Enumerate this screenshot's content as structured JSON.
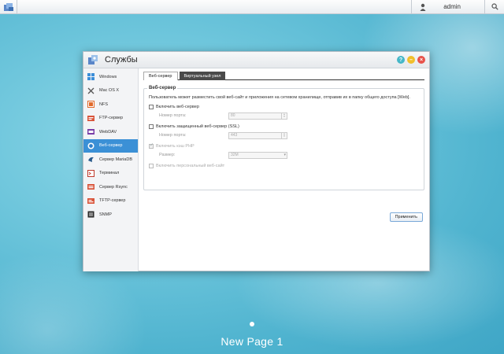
{
  "topbar": {
    "user_name": "admin"
  },
  "window": {
    "title": "Службы"
  },
  "sidebar": {
    "items": [
      {
        "label": "Windows",
        "icon": "windows-icon",
        "active": false
      },
      {
        "label": "Mac OS X",
        "icon": "mac-icon",
        "active": false
      },
      {
        "label": "NFS",
        "icon": "nfs-icon",
        "active": false
      },
      {
        "label": "FTP-сервер",
        "icon": "ftp-icon",
        "active": false
      },
      {
        "label": "WebDAV",
        "icon": "webdav-icon",
        "active": false
      },
      {
        "label": "Веб-сервер",
        "icon": "web-server-icon",
        "active": true
      },
      {
        "label": "Сервер MariaDB",
        "icon": "mariadb-icon",
        "active": false
      },
      {
        "label": "Терминал",
        "icon": "terminal-icon",
        "active": false
      },
      {
        "label": "Сервер Rsync",
        "icon": "rsync-icon",
        "active": false
      },
      {
        "label": "TFTP-сервер",
        "icon": "tftp-icon",
        "active": false
      },
      {
        "label": "SNMP",
        "icon": "snmp-icon",
        "active": false
      }
    ]
  },
  "tabs": [
    {
      "label": "Веб-сервер",
      "active": true
    },
    {
      "label": "Виртуальный узел",
      "active": false
    }
  ],
  "section": {
    "legend": "Веб-сервер",
    "description": "Пользователь может разместить свой веб-сайт и приложения на сетевом хранилище, отправив их в папку общего доступа [Web].",
    "enable_web": {
      "label": "Включить веб-сервер",
      "checked": false
    },
    "port_label": "Номер порта:",
    "port_value": "80",
    "enable_ssl": {
      "label": "Включить защищенный веб-сервер (SSL)",
      "checked": false
    },
    "ssl_port_label": "Номер порта:",
    "ssl_port_value": "443",
    "php_cache": {
      "label": "Включить кэш PHP",
      "checked": true,
      "disabled": true
    },
    "size_label": "Размер:",
    "size_value": "32M",
    "personal_site": {
      "label": "Включить персональный веб-сайт",
      "checked": false,
      "disabled": true
    }
  },
  "apply_label": "Применить",
  "page_label": "New Page 1",
  "colors": {
    "accent": "#3b90d6",
    "tab_inactive": "#4a4a4a"
  }
}
